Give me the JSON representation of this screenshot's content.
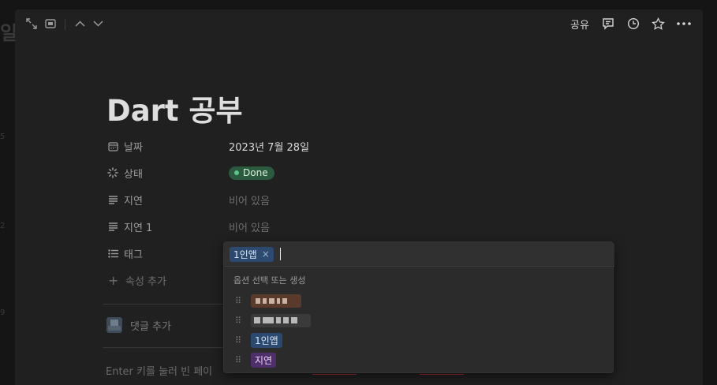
{
  "background": {
    "title_fragment": "일경",
    "line_numbers": [
      "5",
      "2",
      "9"
    ]
  },
  "topbar": {
    "icons": [
      "expand-icon",
      "peek-mode-icon",
      "chevron-up-icon",
      "chevron-down-icon"
    ],
    "share_label": "공유",
    "right_icons": [
      "comment-icon",
      "history-icon",
      "star-icon",
      "more-icon"
    ]
  },
  "page": {
    "title": "Dart 공부",
    "properties": [
      {
        "icon": "calendar-icon",
        "name": "날짜",
        "value": "2023년 7월 28일"
      },
      {
        "icon": "status-icon",
        "name": "상태",
        "value": "Done"
      },
      {
        "icon": "text-icon",
        "name": "지연",
        "value": "비어 있음"
      },
      {
        "icon": "text-icon",
        "name": "지연 1",
        "value": "비어 있음"
      },
      {
        "icon": "multi-select-icon",
        "name": "태그",
        "value": ""
      }
    ],
    "add_property": "속성 추가",
    "add_comment": "댓글 추가",
    "hint": "Enter 키를 눌러 빈 페이"
  },
  "status_color": "#2b5a3e",
  "tag_popup": {
    "selected_tag": "1인앱",
    "remove_symbol": "×",
    "header": "옵션 선택 또는 생성",
    "options": [
      {
        "label": "",
        "redacted": true,
        "color": "#5a3a2a"
      },
      {
        "label": "",
        "redacted": true,
        "color": "#3a3a3a"
      },
      {
        "label": "1인앱",
        "redacted": false,
        "color": "#2c4a70"
      },
      {
        "label": "지연",
        "redacted": false,
        "color": "#4f2f6a"
      }
    ]
  }
}
